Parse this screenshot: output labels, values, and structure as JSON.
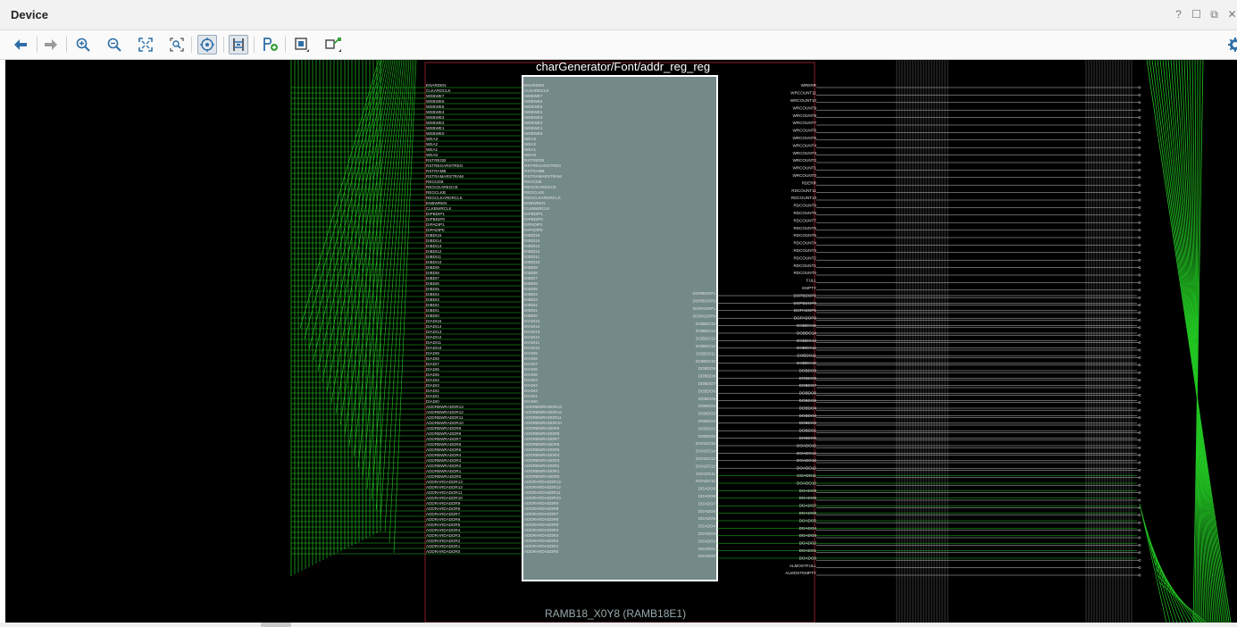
{
  "window": {
    "title": "Device",
    "controls": [
      {
        "name": "help-icon",
        "glyph": "?"
      },
      {
        "name": "restore-icon",
        "glyph": "☐"
      },
      {
        "name": "float-icon",
        "glyph": "⧉"
      },
      {
        "name": "close-icon",
        "glyph": "✕"
      }
    ]
  },
  "toolbar": {
    "buttons": [
      {
        "name": "back-button",
        "icon": "arrow-left-icon"
      },
      {
        "name": "forward-button",
        "icon": "arrow-right-icon"
      },
      {
        "name": "zoom-in-button",
        "icon": "zoom-in-icon"
      },
      {
        "name": "zoom-out-button",
        "icon": "zoom-out-icon"
      },
      {
        "name": "zoom-fit-button",
        "icon": "zoom-fit-icon"
      },
      {
        "name": "zoom-area-button",
        "icon": "zoom-area-icon"
      },
      {
        "name": "autofit-selection-button",
        "icon": "target-icon",
        "active": true
      },
      {
        "name": "routing-resources-button",
        "icon": "routing-icon",
        "active": true
      },
      {
        "name": "add-pblock-button",
        "icon": "pblock-add-icon"
      },
      {
        "name": "device-view-options-button",
        "icon": "device-options-icon"
      },
      {
        "name": "layout-options-button",
        "icon": "layout-options-icon"
      }
    ],
    "settings_icon": "gear-icon"
  },
  "device_view": {
    "cell_name": "charGenerator/Font/addr_reg_reg",
    "site_name": "RAMB18_X0Y8 (RAMB18E1)",
    "colors": {
      "background": "#000000",
      "block_fill": "#738a89",
      "block_border": "#ffffff",
      "net": "#22c422",
      "pin_line": "#c8c8c8",
      "pin_text": "#e0e0e0",
      "site_outline": "#8b1a2a",
      "column_lines": "#8a8a8a"
    },
    "left_pins": [
      "ENARDEN",
      "CLKARDCLK",
      "WEBWE7",
      "WEBWE6",
      "WEBWE5",
      "WEBWE4",
      "WEBWE3",
      "WEBWE2",
      "WEBWE1",
      "WEBWE0",
      "WEA3",
      "WEA2",
      "WEA1",
      "WEA0",
      "RSTREGB",
      "RSTREGARSTREG",
      "RSTRAMB",
      "RSTRAMARSTRAM",
      "REGCEB",
      "REGCEAREGCE",
      "REGCLKB",
      "REGCLKARDRCLK",
      "ENBWREN",
      "CLKBWRCLK",
      "DIPBDIP1",
      "DIPBDIP0",
      "DIPADIP1",
      "DIPADIP0",
      "DIBDI15",
      "DIBDI14",
      "DIBDI13",
      "DIBDI12",
      "DIBDI11",
      "DIBDI10",
      "DIBDI9",
      "DIBDI8",
      "DIBDI7",
      "DIBDI6",
      "DIBDI5",
      "DIBDI4",
      "DIBDI3",
      "DIBDI2",
      "DIBDI1",
      "DIBDI0",
      "DIADI15",
      "DIADI14",
      "DIADI13",
      "DIADI12",
      "DIADI11",
      "DIADI10",
      "DIADI9",
      "DIADI8",
      "DIADI7",
      "DIADI6",
      "DIADI5",
      "DIADI4",
      "DIADI3",
      "DIADI2",
      "DIADI1",
      "DIADI0",
      "ADDRBWRADDR13",
      "ADDRBWRADDR12",
      "ADDRBWRADDR11",
      "ADDRBWRADDR10",
      "ADDRBWRADDR9",
      "ADDRBWRADDR8",
      "ADDRBWRADDR7",
      "ADDRBWRADDR6",
      "ADDRBWRADDR5",
      "ADDRBWRADDR4",
      "ADDRBWRADDR3",
      "ADDRBWRADDR2",
      "ADDRBWRADDR1",
      "ADDRBWRADDR0",
      "ADDRARDADDR13",
      "ADDRARDADDR12",
      "ADDRARDADDR11",
      "ADDRARDADDR10",
      "ADDRARDADDR9",
      "ADDRARDADDR8",
      "ADDRARDADDR7",
      "ADDRARDADDR6",
      "ADDRARDADDR5",
      "ADDRARDADDR4",
      "ADDRARDADDR3",
      "ADDRARDADDR2",
      "ADDRARDADDR1",
      "ADDRARDADDR0"
    ],
    "right_pins": [
      "DOPBDOP1",
      "DOPBDOP0",
      "DOPADOP1",
      "DOPADOP0",
      "DOBDO15",
      "DOBDO14",
      "DOBDO13",
      "DOBDO12",
      "DOBDO11",
      "DOBDO10",
      "DOBDO9",
      "DOBDO8",
      "DOBDO7",
      "DOBDO6",
      "DOBDO5",
      "DOBDO4",
      "DOBDO3",
      "DOBDO2",
      "DOBDO1",
      "DOBDO0",
      "DOADO15",
      "DOADO14",
      "DOADO13",
      "DOADO12",
      "DOADO11",
      "DOADO10",
      "DOADO9",
      "DOADO8",
      "DOADO7",
      "DOADO6",
      "DOADO5",
      "DOADO4",
      "DOADO3",
      "DOADO2",
      "DOADO1",
      "DOADO0"
    ],
    "far_right_pins": [
      "WRERR",
      "WRCOUNT11",
      "WRCOUNT10",
      "WRCOUNT9",
      "WRCOUNT8",
      "WRCOUNT7",
      "WRCOUNT6",
      "WRCOUNT5",
      "WRCOUNT4",
      "WRCOUNT3",
      "WRCOUNT2",
      "WRCOUNT1",
      "WRCOUNT0",
      "RDERR",
      "RDCOUNT11",
      "RDCOUNT10",
      "RDCOUNT9",
      "RDCOUNT8",
      "RDCOUNT7",
      "RDCOUNT6",
      "RDCOUNT5",
      "RDCOUNT4",
      "RDCOUNT3",
      "RDCOUNT2",
      "RDCOUNT1",
      "RDCOUNT0",
      "FULL",
      "EMPTY",
      "DOPBDOP1",
      "DOPBDOP0",
      "DOPADOP1",
      "DOPADOP0",
      "DOBDO15",
      "DOBDO14",
      "DOBDO13",
      "DOBDO12",
      "DOBDO11",
      "DOBDO10",
      "DOBDO9",
      "DOBDO8",
      "DOBDO7",
      "DOBDO6",
      "DOBDO5",
      "DOBDO4",
      "DOBDO3",
      "DOBDO2",
      "DOBDO1",
      "DOBDO0",
      "DOADO15",
      "DOADO14",
      "DOADO13",
      "DOADO12",
      "DOADO11",
      "DOADO10",
      "DOADO9",
      "DOADO8",
      "DOADO7",
      "DOADO6",
      "DOADO5",
      "DOADO4",
      "DOADO3",
      "DOADO2",
      "DOADO1",
      "DOADO0",
      "ALMOSTFULL",
      "ALMOSTEMPTY"
    ]
  }
}
